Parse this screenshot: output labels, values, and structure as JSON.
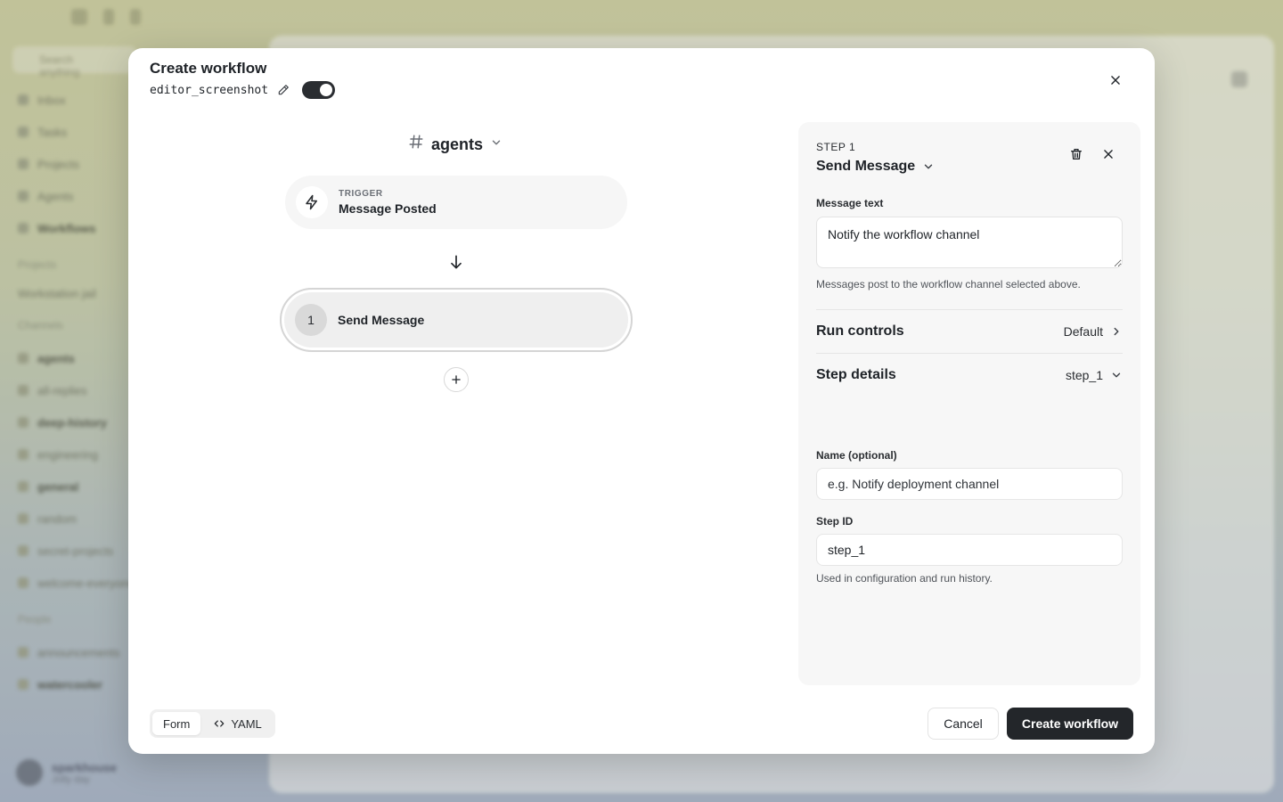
{
  "background": {
    "search_placeholder": "Search anything",
    "nav": [
      "Inbox",
      "Tasks",
      "Projects",
      "Agents",
      "Workflows"
    ],
    "section_projects": "Projects",
    "project_item": "Workstation jail",
    "section_channels": "Channels",
    "channels": [
      "agents",
      "all-replies",
      "deep-history",
      "engineering",
      "general",
      "random",
      "secret-projects",
      "welcome-everyone"
    ],
    "section_people": "People",
    "people": [
      "announcements",
      "watercooler"
    ],
    "user_name": "sparkhouse",
    "user_status": "Jolly day"
  },
  "modal": {
    "title": "Create workflow",
    "workflow_name": "editor_screenshot",
    "enabled": true
  },
  "canvas": {
    "channel": "agents",
    "trigger": {
      "label": "TRIGGER",
      "value": "Message Posted"
    },
    "steps": [
      {
        "number": "1",
        "name": "Send Message"
      }
    ]
  },
  "panel": {
    "step_index": "STEP 1",
    "step_action": "Send Message",
    "message_text_label": "Message text",
    "message_text_value": "Notify the workflow channel",
    "message_text_help": "Messages post to the workflow channel selected above.",
    "run_controls": {
      "title": "Run controls",
      "value": "Default"
    },
    "step_details": {
      "title": "Step details",
      "value": "step_1"
    },
    "name_label": "Name (optional)",
    "name_placeholder": "e.g. Notify deployment channel",
    "step_id_label": "Step ID",
    "step_id_value": "step_1",
    "step_id_help": "Used in configuration and run history."
  },
  "footer": {
    "mode_form": "Form",
    "mode_yaml": "YAML",
    "active_mode": "Form",
    "cancel_label": "Cancel",
    "create_label": "Create workflow"
  },
  "colors": {
    "primary_button": "#23262a",
    "toggle_on": "#2a2d31",
    "panel_bg": "#f7f7f7"
  }
}
